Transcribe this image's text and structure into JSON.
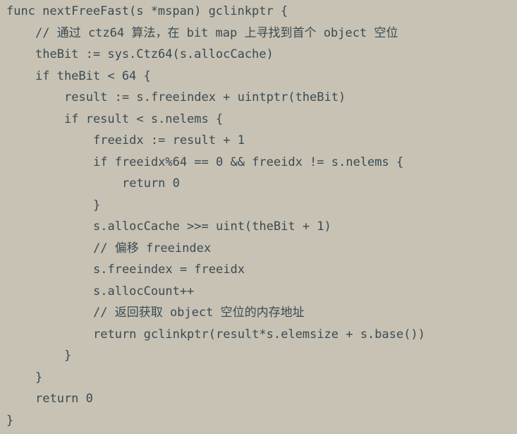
{
  "colors": {
    "background": "#c7c2b3",
    "text": "#3b4b55"
  },
  "code": {
    "lines": [
      "func nextFreeFast(s *mspan) gclinkptr {",
      "// 通过 ctz64 算法，在 bit map 上寻找到首个 object 空位",
      "theBit := sys.Ctz64(s.allocCache)",
      "if theBit < 64 {",
      "result := s.freeindex + uintptr(theBit)",
      "if result < s.nelems {",
      "freeidx := result + 1",
      "if freeidx%64 == 0 && freeidx != s.nelems {",
      "return 0",
      "}",
      "s.allocCache >>= uint(theBit + 1)",
      "// 偏移 freeindex",
      "s.freeindex = freeidx",
      "s.allocCount++",
      "// 返回获取 object 空位的内存地址",
      "return gclinkptr(result*s.elemsize + s.base())",
      "}",
      "}",
      "return 0",
      "}"
    ]
  }
}
